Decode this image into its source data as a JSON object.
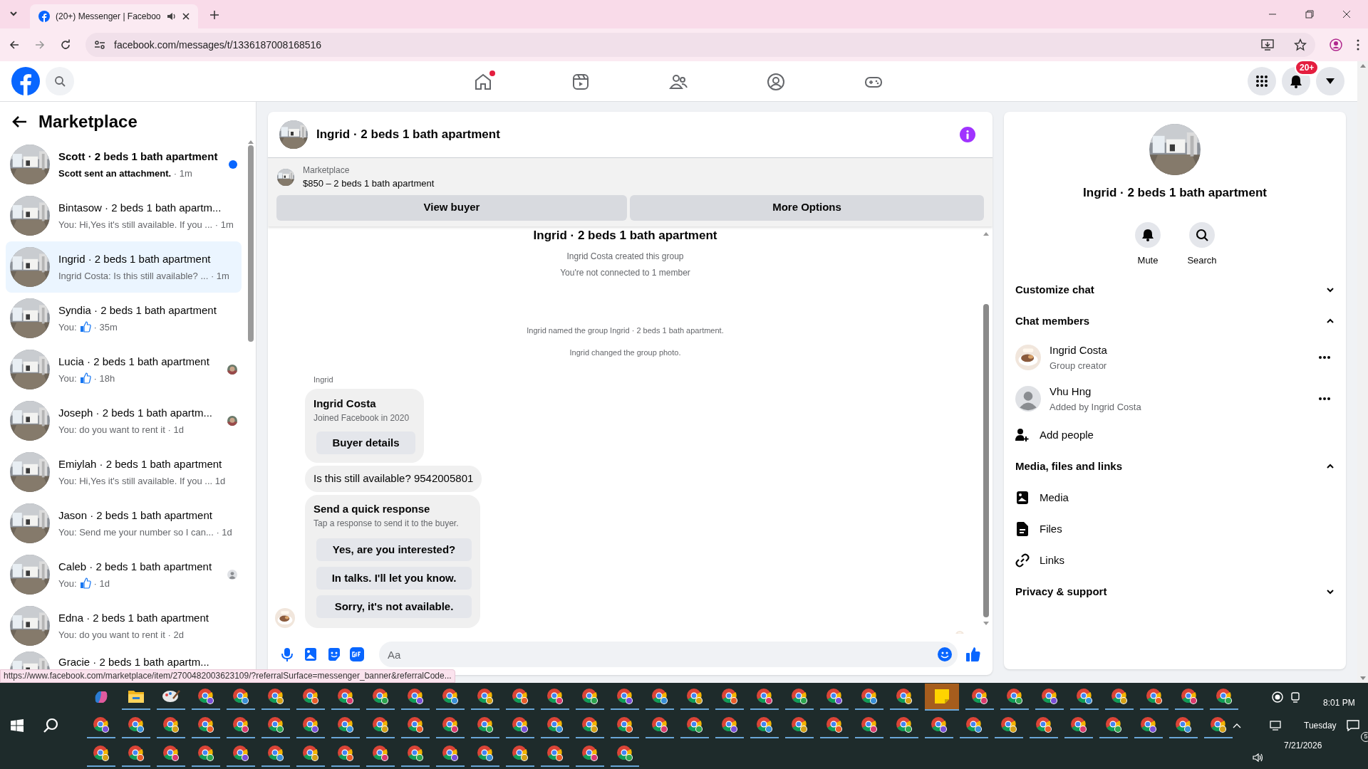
{
  "browser": {
    "tab_title": "(20+) Messenger | Faceboo",
    "url": "facebook.com/messages/t/1336187008168516",
    "status_url": "https://www.facebook.com/marketplace/item/2700482003623109/?referralSurface=messenger_banner&referralCode..."
  },
  "nav": {
    "tabs": [
      {
        "kind": "home",
        "notified": true
      },
      {
        "kind": "video",
        "notified": false
      },
      {
        "kind": "friends",
        "notified": false
      },
      {
        "kind": "groups",
        "notified": false
      },
      {
        "kind": "gaming",
        "notified": false
      }
    ],
    "notification_badge": "20+"
  },
  "sidebar": {
    "title": "Marketplace",
    "conversations": [
      {
        "title": "Scott · 2 beds 1 bath apartment",
        "preview": "Scott sent an attachment.",
        "liked": false,
        "time": "· 1m",
        "unread": true,
        "selected": false
      },
      {
        "title": "Bintasow · 2 beds 1 bath apartm...",
        "preview": "You: Hi,Yes it's still available. If you ...",
        "liked": false,
        "time": "· 1m",
        "unread": false,
        "selected": false
      },
      {
        "title": "Ingrid · 2 beds 1 bath apartment",
        "preview": "Ingrid Costa: Is this still available? ...",
        "liked": false,
        "time": "· 1m",
        "unread": false,
        "selected": true
      },
      {
        "title": "Syndia · 2 beds 1 bath apartment",
        "preview": "You:",
        "liked": true,
        "time": "· 35m",
        "unread": false,
        "selected": false
      },
      {
        "title": "Lucia · 2 beds 1 bath apartment",
        "preview": "You:",
        "liked": true,
        "time": "· 18h",
        "unread": false,
        "selected": false
      },
      {
        "title": "Joseph · 2 beds 1 bath apartm...",
        "preview": "You: do you want to rent it",
        "liked": false,
        "time": "· 1d",
        "unread": false,
        "selected": false
      },
      {
        "title": "Emiylah · 2 beds 1 bath apartment",
        "preview": "You: Hi,Yes it's still available. If you ...",
        "liked": false,
        "time": "1d",
        "unread": false,
        "selected": false
      },
      {
        "title": "Jason · 2 beds 1 bath apartment",
        "preview": "You: Send me your number so I can...",
        "liked": false,
        "time": "· 1d",
        "unread": false,
        "selected": false
      },
      {
        "title": "Caleb · 2 beds 1 bath apartment",
        "preview": "You:",
        "liked": true,
        "time": "· 1d",
        "unread": false,
        "selected": false,
        "receipt": {
          "kind": "silhouette"
        }
      },
      {
        "title": "Edna · 2 beds 1 bath apartment",
        "preview": "You: do you want to rent it",
        "liked": false,
        "time": "· 2d",
        "unread": false,
        "selected": false
      },
      {
        "title": "Gracie · 2 beds 1 bath apartm...",
        "unread": false,
        "selected": false
      }
    ]
  },
  "chat": {
    "title": "Ingrid · 2 beds 1 bath apartment",
    "banner": {
      "label": "Marketplace",
      "listing": "$850 – 2 beds 1 bath apartment",
      "buttons": [
        "View buyer",
        "More Options"
      ]
    },
    "group_title": "Ingrid · 2 beds 1 bath apartment",
    "intro": [
      "Ingrid Costa created this group",
      "You're not connected to 1 member"
    ],
    "events": [
      "Ingrid named the group Ingrid · 2 beds 1 bath apartment.",
      "Ingrid changed the group photo."
    ],
    "sender": "Ingrid",
    "buyer_card": {
      "name": "Ingrid Costa",
      "subtitle": "Joined Facebook in 2020",
      "button": "Buyer details"
    },
    "message": "Is this still available? 9542005801",
    "quick_response": {
      "title": "Send a quick response",
      "subtitle": "Tap a response to send it to the buyer.",
      "options": [
        "Yes, are you interested?",
        "In talks. I'll let you know.",
        "Sorry, it's not available."
      ]
    },
    "composer": {
      "placeholder": "Aa"
    }
  },
  "details": {
    "title": "Ingrid · 2 beds 1 bath apartment",
    "actions": [
      {
        "kind": "mute",
        "label": "Mute"
      },
      {
        "kind": "search",
        "label": "Search"
      }
    ],
    "sections": [
      {
        "title": "Customize chat",
        "expanded": false
      },
      {
        "title": "Chat members",
        "expanded": true,
        "members": [
          {
            "name": "Ingrid Costa",
            "role": "Group creator"
          },
          {
            "name": "Vhu Hng",
            "role": "Added by Ingrid Costa",
            "kind": "silhouette"
          }
        ],
        "items": [
          {
            "kind": "add",
            "label": "Add people"
          }
        ]
      },
      {
        "title": "Media, files and links",
        "expanded": true,
        "items": [
          {
            "kind": "media",
            "label": "Media"
          },
          {
            "kind": "files",
            "label": "Files"
          },
          {
            "kind": "links",
            "label": "Links"
          }
        ]
      },
      {
        "title": "Privacy & support",
        "expanded": false
      }
    ]
  },
  "taskbar": {
    "time": "8:01 PM",
    "day": "Tuesday",
    "date": "7/21/2026",
    "notifications": "5"
  }
}
